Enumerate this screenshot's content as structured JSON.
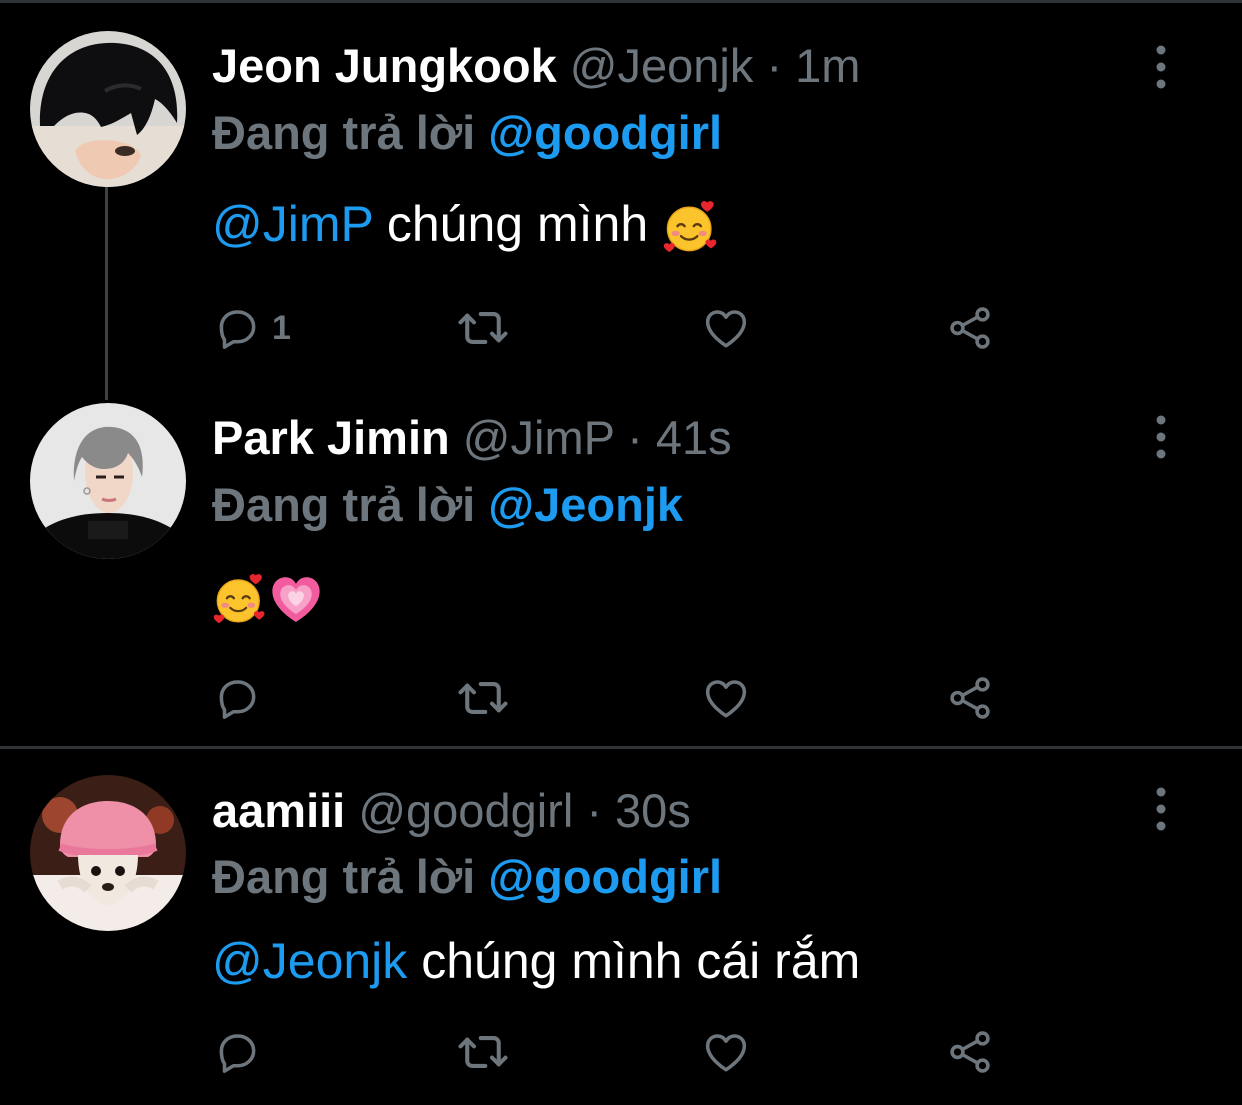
{
  "colors": {
    "background": "#000000",
    "muted": "#6e767d",
    "accent": "#1d9bf0",
    "divider": "#2f3336"
  },
  "tweets": [
    {
      "name": "Jeon Jungkook",
      "handle": "@Jeonjk",
      "separator": "·",
      "time": "1m",
      "replying_label": "Đang trả lời",
      "replying_to": "@goodgirl",
      "mention": "@JimP",
      "text": "chúng mình",
      "emoji": "smiling-face-with-hearts",
      "reply_count": "1"
    },
    {
      "name": "Park Jimin",
      "handle": "@JimP",
      "separator": "·",
      "time": "41s",
      "replying_label": "Đang trả lời",
      "replying_to": "@Jeonjk",
      "emoji": [
        "smiling-face-with-hearts",
        "growing-heart"
      ],
      "reply_count": ""
    },
    {
      "name": "aamiii",
      "handle": "@goodgirl",
      "separator": "·",
      "time": "30s",
      "replying_label": "Đang trả lời",
      "replying_to": "@goodgirl",
      "mention": "@Jeonjk",
      "text": "chúng mình cái rắm",
      "reply_count": ""
    }
  ],
  "icons": {
    "reply": "speech-bubble-icon",
    "retweet": "retweet-icon",
    "like": "heart-icon",
    "share": "share-icon",
    "more": "more-vertical-icon"
  }
}
